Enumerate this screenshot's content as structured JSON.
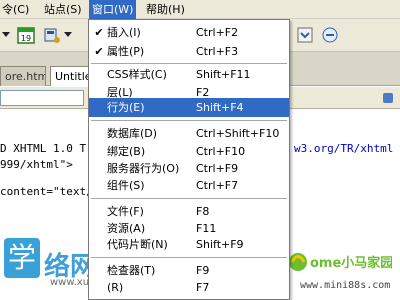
{
  "menubar": {
    "items": [
      {
        "label": "令(C)"
      },
      {
        "label": "站点(S)"
      },
      {
        "label": "窗口(W)"
      },
      {
        "label": "帮助(H)"
      }
    ]
  },
  "tabs": [
    "ore.html",
    "Untitled"
  ],
  "code_lines": [
    {
      "prefix": "D XHTML 1.0 T",
      "suffix": "w3.org/TR/xhtml"
    },
    {
      "prefix": "999/xhtml\">",
      "suffix": ""
    },
    {
      "prefix": "content=\"text/",
      "suffix": ""
    }
  ],
  "window_menu": {
    "items": [
      {
        "label": "插入(I)",
        "shortcut": "Ctrl+F2",
        "checked": true
      },
      {
        "label": "属性(P)",
        "shortcut": "Ctrl+F3",
        "checked": true
      },
      {
        "label": "CSS样式(C)",
        "shortcut": "Shift+F11"
      },
      {
        "label": "层(L)",
        "shortcut": "F2"
      },
      {
        "label": "行为(E)",
        "shortcut": "Shift+F4",
        "highlighted": true
      },
      {
        "label": "数据库(D)",
        "shortcut": "Ctrl+Shift+F10"
      },
      {
        "label": "绑定(B)",
        "shortcut": "Ctrl+F10"
      },
      {
        "label": "服务器行为(O)",
        "shortcut": "Ctrl+F9"
      },
      {
        "label": "组件(S)",
        "shortcut": "Ctrl+F7"
      },
      {
        "label": "文件(F)",
        "shortcut": "F8"
      },
      {
        "label": "资源(A)",
        "shortcut": "F11"
      },
      {
        "label": "代码片断(N)",
        "shortcut": "Shift+F9"
      },
      {
        "label": "检查器(T)",
        "shortcut": "F9"
      },
      {
        "label": "(R)",
        "shortcut": "F7"
      }
    ]
  },
  "watermark": {
    "logo_char": "学",
    "big_text": "络网站",
    "url": "www.xuewangzhan.net",
    "home_name": "ome小马家园",
    "home_url": "www.mini88s.com"
  },
  "colors": {
    "highlight": "#316ac5",
    "menubar": "#ece9d8"
  }
}
